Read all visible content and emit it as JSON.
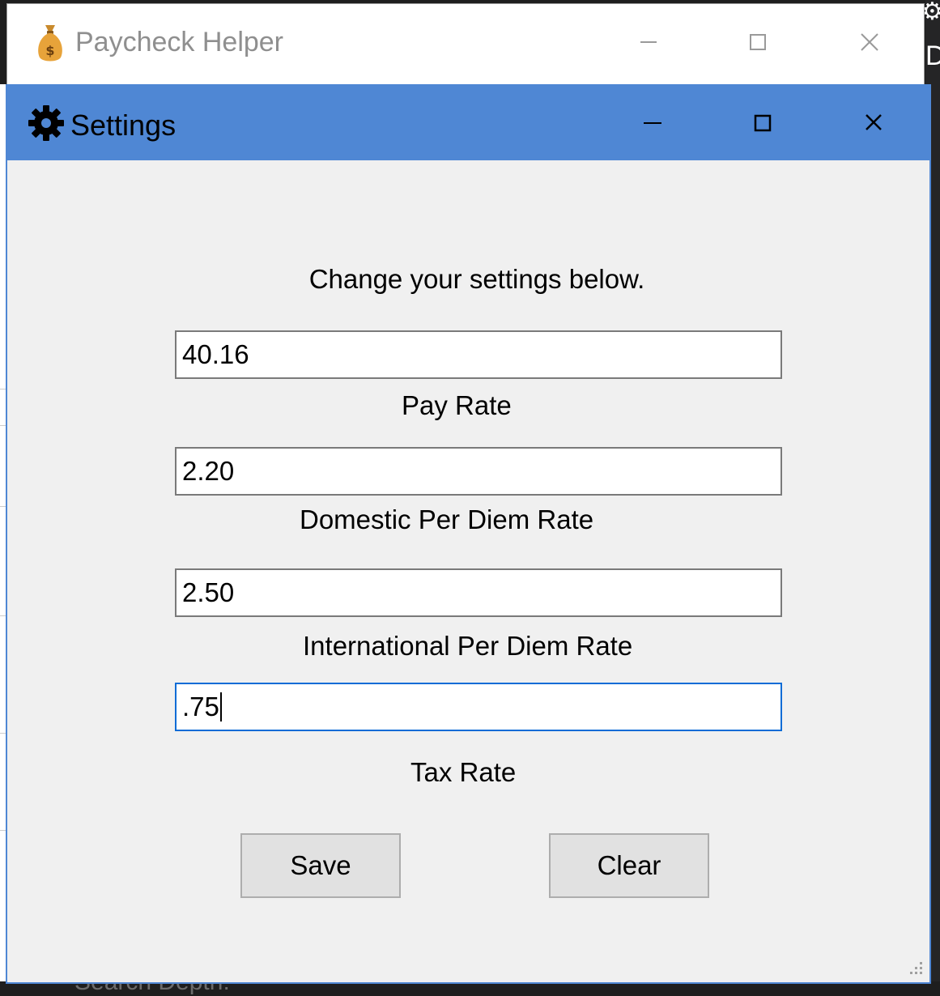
{
  "app_window": {
    "title": "Paycheck Helper",
    "icon": "money-bag-icon"
  },
  "settings_window": {
    "title": "Settings",
    "icon": "gear-icon",
    "prompt": "Change your settings below.",
    "fields": [
      {
        "value": ".75",
        "label": "Tax Rate"
      }
    ],
    "pay_rate": {
      "value": "40.16",
      "label": "Pay Rate"
    },
    "domestic_per_diem": {
      "value": "2.20",
      "label": "Domestic Per Diem Rate"
    },
    "international_per_diem": {
      "value": "2.50",
      "label": "International Per Diem Rate"
    },
    "tax_rate": {
      "value": ".75",
      "label": "Tax Rate",
      "focused": true
    },
    "buttons": {
      "save": "Save",
      "clear": "Clear"
    },
    "accent_color": "#4f87d4"
  },
  "background": {
    "right_glyph": "D",
    "bottom_text": "Search Depth:"
  }
}
